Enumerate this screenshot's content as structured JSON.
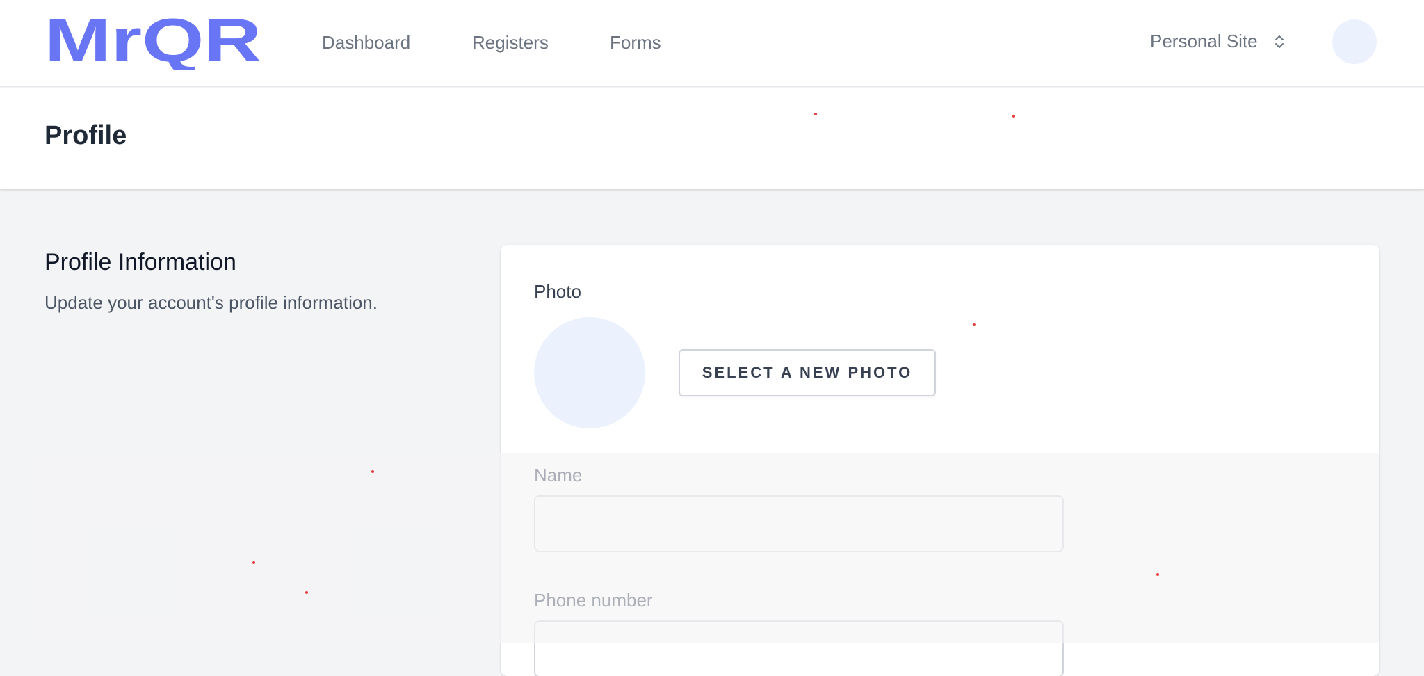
{
  "brand": {
    "logo_text": "MrQR",
    "color": "#6875f5"
  },
  "nav": {
    "links": [
      "Dashboard",
      "Registers",
      "Forms"
    ],
    "team_label": "Personal Site",
    "team_icon": "chevron-up-down-icon"
  },
  "header": {
    "title": "Profile"
  },
  "section": {
    "title": "Profile Information",
    "description": "Update your account's profile information."
  },
  "form": {
    "photo_label": "Photo",
    "select_photo_label": "SELECT A NEW PHOTO",
    "fields": [
      {
        "label": "Name",
        "value": ""
      },
      {
        "label": "Phone number",
        "value": ""
      }
    ]
  },
  "colors": {
    "page_bg": "#f3f4f6",
    "avatar_placeholder": "#ebf2fe",
    "text_primary": "#111827",
    "text_secondary": "#6b7280"
  }
}
